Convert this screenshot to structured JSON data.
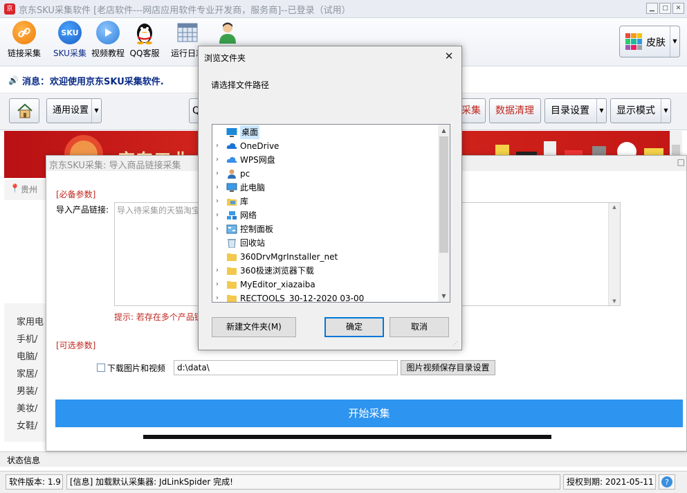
{
  "window": {
    "title": "京东SKU采集软件 [老店软件---网店应用软件专业开发商，服务商]--已登录（试用）",
    "logo_text": "京"
  },
  "toolbar": {
    "items": [
      {
        "label": "链接采集",
        "icon": "link-icon"
      },
      {
        "label": "SKU采集",
        "icon": "sku-icon",
        "icon_text": "SKU"
      },
      {
        "label": "视频教程",
        "icon": "play-icon"
      },
      {
        "label": "QQ客服",
        "icon": "qq-penguin-icon"
      },
      {
        "label": "运行日志",
        "icon": "calendar-grid-icon"
      },
      {
        "label": "",
        "icon": "user-icon"
      }
    ],
    "skin_label": "皮肤"
  },
  "message": {
    "label": "消息：",
    "text": "欢迎使用京东SKU采集软件."
  },
  "buttons": {
    "general_settings": "通用设置",
    "collect": "采集",
    "data_clean": "数据清理",
    "dir_settings": "目录设置",
    "display_mode": "显示模式"
  },
  "sidebar": {
    "location": "贵州",
    "categories": [
      "家用电",
      "手机/",
      "电脑/",
      "家居/",
      "男装/",
      "美妆/",
      "女鞋/"
    ]
  },
  "status": {
    "info_label": "状态信息",
    "version": "软件版本: 1.9",
    "log": "[信息] 加载默认采集器: JdLinkSpider 完成!",
    "license": "授权到期: 2021-05-11"
  },
  "import_dialog": {
    "title": "京东SKU采集: 导入商品链接采集",
    "required_label": "[必备参数]",
    "link_label": "导入产品链接:",
    "link_placeholder": "导入待采集的天猫淘宝",
    "tip": "提示: 若存在多个产品链",
    "optional_label": "[可选参数]",
    "download_label": "下载图片和视频",
    "download_dir": "d:\\data\\",
    "dir_button": "图片视频保存目录设置",
    "start_button": "开始采集"
  },
  "browse_dialog": {
    "title": "浏览文件夹",
    "prompt": "请选择文件路径",
    "tree": [
      {
        "label": "桌面",
        "icon": "desktop-icon",
        "selected": true,
        "expand": false
      },
      {
        "label": "OneDrive",
        "icon": "cloud-icon",
        "expand": true
      },
      {
        "label": "WPS网盘",
        "icon": "wps-cloud-icon",
        "expand": true
      },
      {
        "label": "pc",
        "icon": "user-icon",
        "expand": true
      },
      {
        "label": "此电脑",
        "icon": "computer-icon",
        "expand": true
      },
      {
        "label": "库",
        "icon": "library-folder-icon",
        "expand": true
      },
      {
        "label": "网络",
        "icon": "network-icon",
        "expand": true
      },
      {
        "label": "控制面板",
        "icon": "control-panel-icon",
        "expand": true
      },
      {
        "label": "回收站",
        "icon": "recycle-bin-icon",
        "expand": false
      },
      {
        "label": "360DrvMgrInstaller_net",
        "icon": "folder-icon",
        "expand": false
      },
      {
        "label": "360极速浏览器下载",
        "icon": "folder-icon",
        "expand": true
      },
      {
        "label": "MyEditor_xiazaiba",
        "icon": "folder-icon",
        "expand": true
      },
      {
        "label": "RECTOOLS_30-12-2020 03-00",
        "icon": "folder-icon",
        "expand": true
      }
    ],
    "new_folder": "新建文件夹(M)",
    "ok": "确定",
    "cancel": "取消"
  },
  "colors": {
    "accent_blue": "#2d94ef",
    "required_red": "#c0271f",
    "message_blue": "#0a2a86",
    "banner_red": "#c41816"
  }
}
